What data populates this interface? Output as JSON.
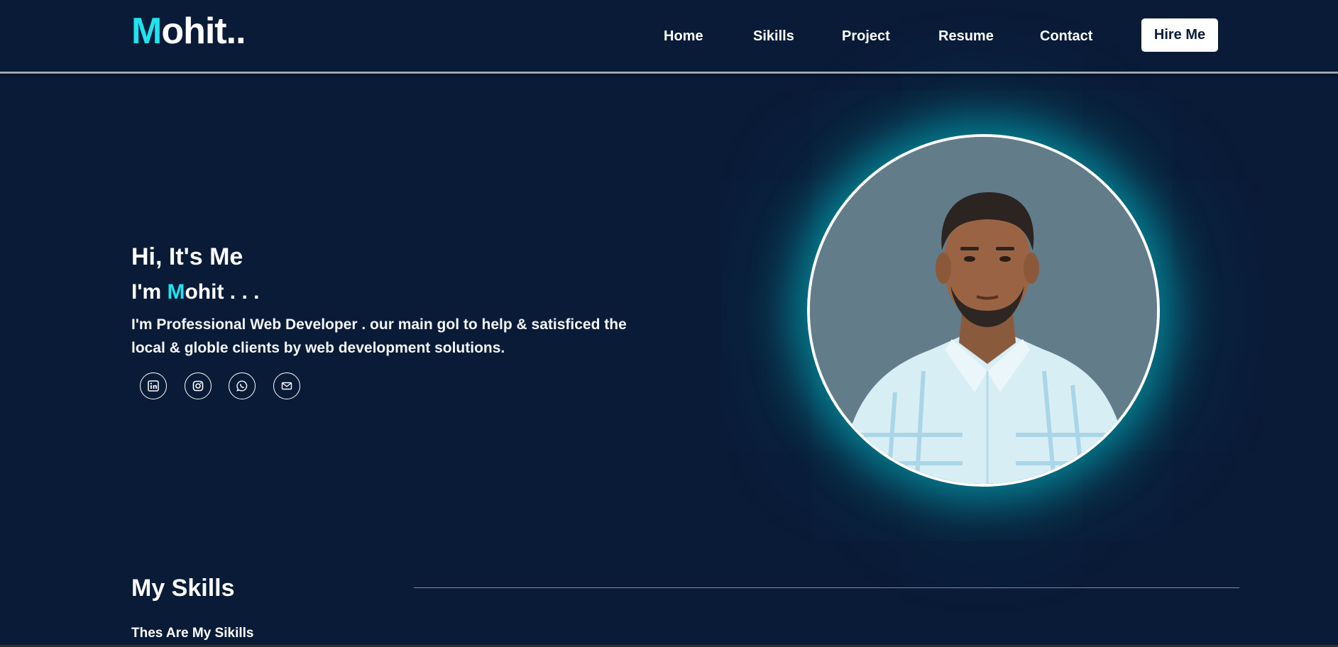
{
  "header": {
    "logo": {
      "accent_letter": "M",
      "rest": "ohit.."
    },
    "nav": [
      "Home",
      "Sikills",
      "Project",
      "Resume",
      "Contact"
    ],
    "hire_label": "Hire Me"
  },
  "hero": {
    "greeting": "Hi, It's Me",
    "name_prefix": "I'm ",
    "name_accent": "M",
    "name_rest": "ohit . . .",
    "description": "I'm Professional Web Developer . our main gol to help & satisficed the local & globle clients by web development solutions.",
    "social_icons": [
      "linkedin-icon",
      "instagram-icon",
      "whatsapp-icon",
      "mail-icon"
    ]
  },
  "skills": {
    "title": "My Skills",
    "subtitle": "Thes Are My Sikills"
  },
  "colors": {
    "background": "#0a1b37",
    "accent": "#1fe3f0",
    "glow": "#00c8d2",
    "photo_bg": "#627c8a"
  }
}
